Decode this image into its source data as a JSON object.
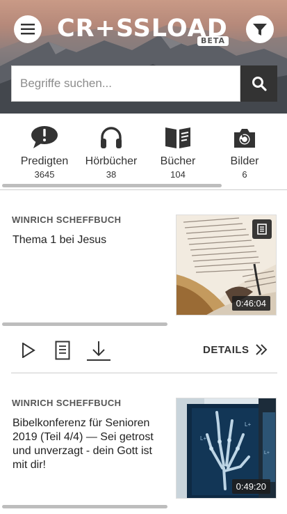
{
  "header": {
    "logo_text": "CR+SSLOAD",
    "badge": "BETA",
    "menu_icon": "hamburger-icon",
    "filter_icon": "funnel-icon"
  },
  "search": {
    "placeholder": "Begriffe suchen...",
    "value": "",
    "button_icon": "magnifier-icon"
  },
  "categories": [
    {
      "label": "Predigten",
      "count": "3645",
      "icon": "speech-bubble-exclamation-icon"
    },
    {
      "label": "Hörbücher",
      "count": "38",
      "icon": "headphones-icon"
    },
    {
      "label": "Bücher",
      "count": "104",
      "icon": "open-book-icon"
    },
    {
      "label": "Bilder",
      "count": "6",
      "icon": "camera-icon"
    }
  ],
  "items": [
    {
      "author": "WINRICH SCHEFFBUCH",
      "title": "Thema 1 bei Jesus",
      "duration": "0:46:04",
      "thumbnail": "open-bible-image",
      "badge_icon": "document-icon"
    },
    {
      "author": "WINRICH SCHEFFBUCH",
      "title": "Bibelkonferenz für Senioren 2019 (Teil 4/4) — Sei getrost und unverzagt - dein Gott ist mit dir!",
      "duration": "0:49:20",
      "thumbnail": "x-ray-hand-image"
    }
  ],
  "actions": {
    "play_icon": "play-icon",
    "document_icon": "document-icon",
    "download_icon": "download-icon",
    "details_label": "DETAILS",
    "details_icon": "double-chevron-right-icon"
  },
  "colors": {
    "dark": "#333333",
    "white": "#ffffff",
    "scrollbar": "#bdbdbd",
    "divider": "#cccccc"
  }
}
